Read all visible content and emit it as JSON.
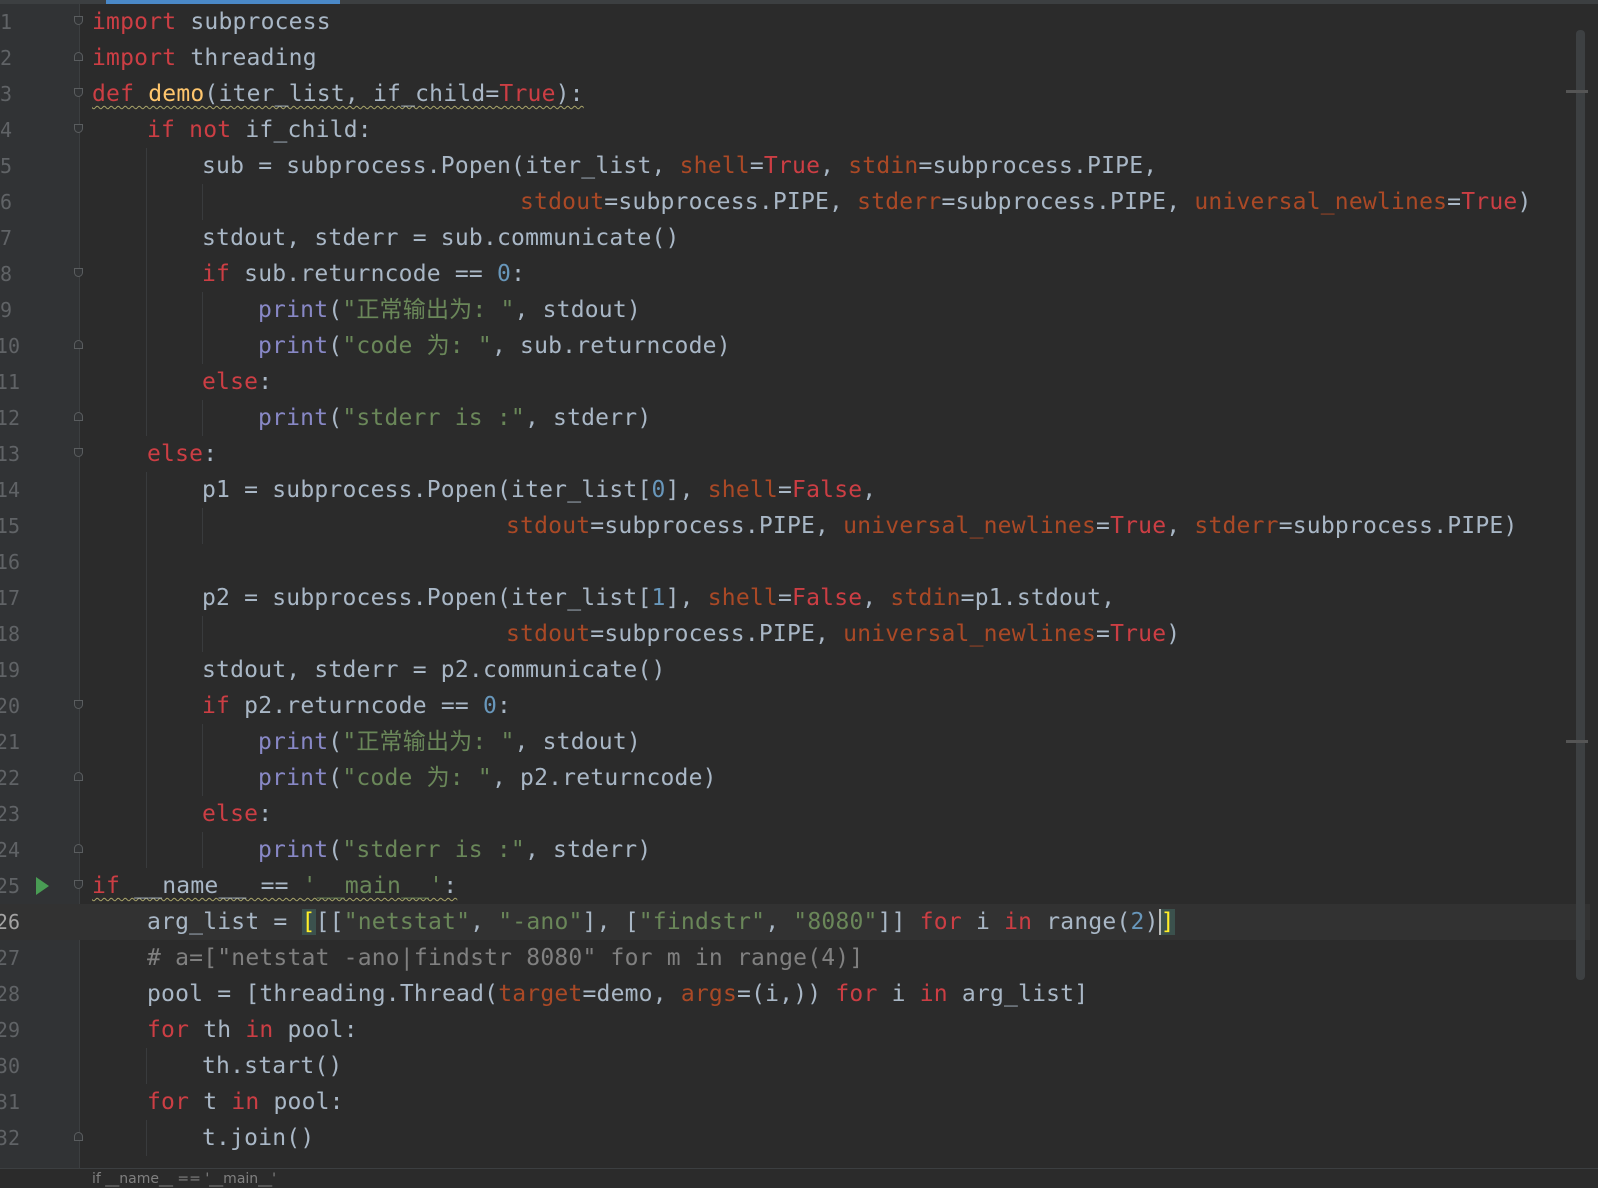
{
  "editor": {
    "language": "python",
    "current_line": 26,
    "breadcrumb": "if __name__ == '__main__'"
  },
  "lines": [
    {
      "n": "1"
    },
    {
      "n": "2"
    },
    {
      "n": "3"
    },
    {
      "n": "4"
    },
    {
      "n": "5"
    },
    {
      "n": "6"
    },
    {
      "n": "7"
    },
    {
      "n": "8"
    },
    {
      "n": "9"
    },
    {
      "n": "10"
    },
    {
      "n": "11"
    },
    {
      "n": "12"
    },
    {
      "n": "13"
    },
    {
      "n": "14"
    },
    {
      "n": "15"
    },
    {
      "n": "16"
    },
    {
      "n": "17"
    },
    {
      "n": "18"
    },
    {
      "n": "19"
    },
    {
      "n": "20"
    },
    {
      "n": "21"
    },
    {
      "n": "22"
    },
    {
      "n": "23"
    },
    {
      "n": "24"
    },
    {
      "n": "25"
    },
    {
      "n": "26"
    },
    {
      "n": "27"
    },
    {
      "n": "28"
    },
    {
      "n": "29"
    },
    {
      "n": "30"
    },
    {
      "n": "31"
    },
    {
      "n": "32"
    }
  ],
  "code": {
    "l1": {
      "k": "import",
      "t": " subprocess"
    },
    "l2": {
      "k": "import",
      "t": " threading"
    },
    "l3": {
      "k": "def",
      "sp": " ",
      "name": "demo",
      "args": "(iter_list, if_child=",
      "v": "True",
      "end": "):"
    },
    "l4": {
      "k1": "if",
      "k2": "not",
      "t": " if_child:"
    },
    "l5": {
      "a": "sub = subprocess.Popen(iter_list, ",
      "p1": "shell",
      "e1": "=",
      "v1": "True",
      "c1": ", ",
      "p2": "stdin",
      "e2": "=subprocess.PIPE,"
    },
    "l6": {
      "p1": "stdout",
      "e1": "=subprocess.PIPE, ",
      "p2": "stderr",
      "e2": "=subprocess.PIPE, ",
      "p3": "universal_newlines",
      "e3": "=",
      "v3": "True",
      "end": ")"
    },
    "l7": {
      "t": "stdout, stderr = sub.communicate()"
    },
    "l8": {
      "k": "if",
      "t": " sub.returncode == ",
      "num": "0",
      "end": ":"
    },
    "l9": {
      "f": "print",
      "o": "(",
      "s": "\"正常输出为: \"",
      "t": ", stdout)"
    },
    "l10": {
      "f": "print",
      "o": "(",
      "s": "\"code 为: \"",
      "t": ", sub.returncode)"
    },
    "l11": {
      "k": "else",
      "t": ":"
    },
    "l12": {
      "f": "print",
      "o": "(",
      "s": "\"stderr is :\"",
      "t": ", stderr)"
    },
    "l13": {
      "k": "else",
      "t": ":"
    },
    "l14": {
      "a": "p1 = subprocess.Popen(iter_list[",
      "num": "0",
      "b": "], ",
      "p1": "shell",
      "e1": "=",
      "v1": "False",
      "end": ","
    },
    "l15": {
      "p1": "stdout",
      "e1": "=subprocess.PIPE, ",
      "p2": "universal_newlines",
      "e2": "=",
      "v2": "True",
      "c2": ", ",
      "p3": "stderr",
      "e3": "=subprocess.PIPE)"
    },
    "l16": {},
    "l17": {
      "a": "p2 = subprocess.Popen(iter_list[",
      "num": "1",
      "b": "], ",
      "p1": "shell",
      "e1": "=",
      "v1": "False",
      "c1": ", ",
      "p2": "stdin",
      "e2": "=p1.stdout,"
    },
    "l18": {
      "p1": "stdout",
      "e1": "=subprocess.PIPE, ",
      "p2": "universal_newlines",
      "e2": "=",
      "v2": "True",
      "end": ")"
    },
    "l19": {
      "t": "stdout, stderr = p2.communicate()"
    },
    "l20": {
      "k": "if",
      "t": " p2.returncode == ",
      "num": "0",
      "end": ":"
    },
    "l21": {
      "f": "print",
      "o": "(",
      "s": "\"正常输出为: \"",
      "t": ", stdout)"
    },
    "l22": {
      "f": "print",
      "o": "(",
      "s": "\"code 为: \"",
      "t": ", p2.returncode)"
    },
    "l23": {
      "k": "else",
      "t": ":"
    },
    "l24": {
      "f": "print",
      "o": "(",
      "s": "\"stderr is :\"",
      "t": ", stderr)"
    },
    "l25": {
      "k": "if",
      "t": " __name__ == ",
      "s": "'__main__'",
      "end": ":"
    },
    "l26": {
      "a": "arg_list = ",
      "br": "[",
      "b2": "[[",
      "s1": "\"netstat\"",
      "c1": ", ",
      "s2": "\"-ano\"",
      "c2": "], [",
      "s3": "\"findstr\"",
      "c3": ", ",
      "s4": "\"8080\"",
      "c4": "]] ",
      "k1": "for",
      "m": " i ",
      "k2": "in",
      "r": " range(",
      "num": "2",
      "rend": ")",
      "br2": "]"
    },
    "l27": {
      "c": "# a=[\"netstat -ano|findstr 8080\" for m in range(4)]"
    },
    "l28": {
      "a": "pool = [threading.Thread(",
      "p1": "target",
      "e1": "=demo, ",
      "p2": "args",
      "e2": "=(i,)) ",
      "k1": "for",
      "m": " i ",
      "k2": "in",
      "end": " arg_list]"
    },
    "l29": {
      "k1": "for",
      "m": " th ",
      "k2": "in",
      "end": " pool:"
    },
    "l30": {
      "t": "th.start()"
    },
    "l31": {
      "k1": "for",
      "m": " t ",
      "k2": "in",
      "end": " pool:"
    },
    "l32": {
      "t": "t.join()"
    }
  },
  "colors": {
    "background": "#2b2b2b",
    "keyword": "#cc3e44",
    "string": "#6a8759",
    "number": "#6897bb",
    "param": "#aa4926",
    "function_name": "#ffc66d",
    "builtin": "#8888c6",
    "comment": "#808080",
    "text": "#a9b7c6"
  }
}
